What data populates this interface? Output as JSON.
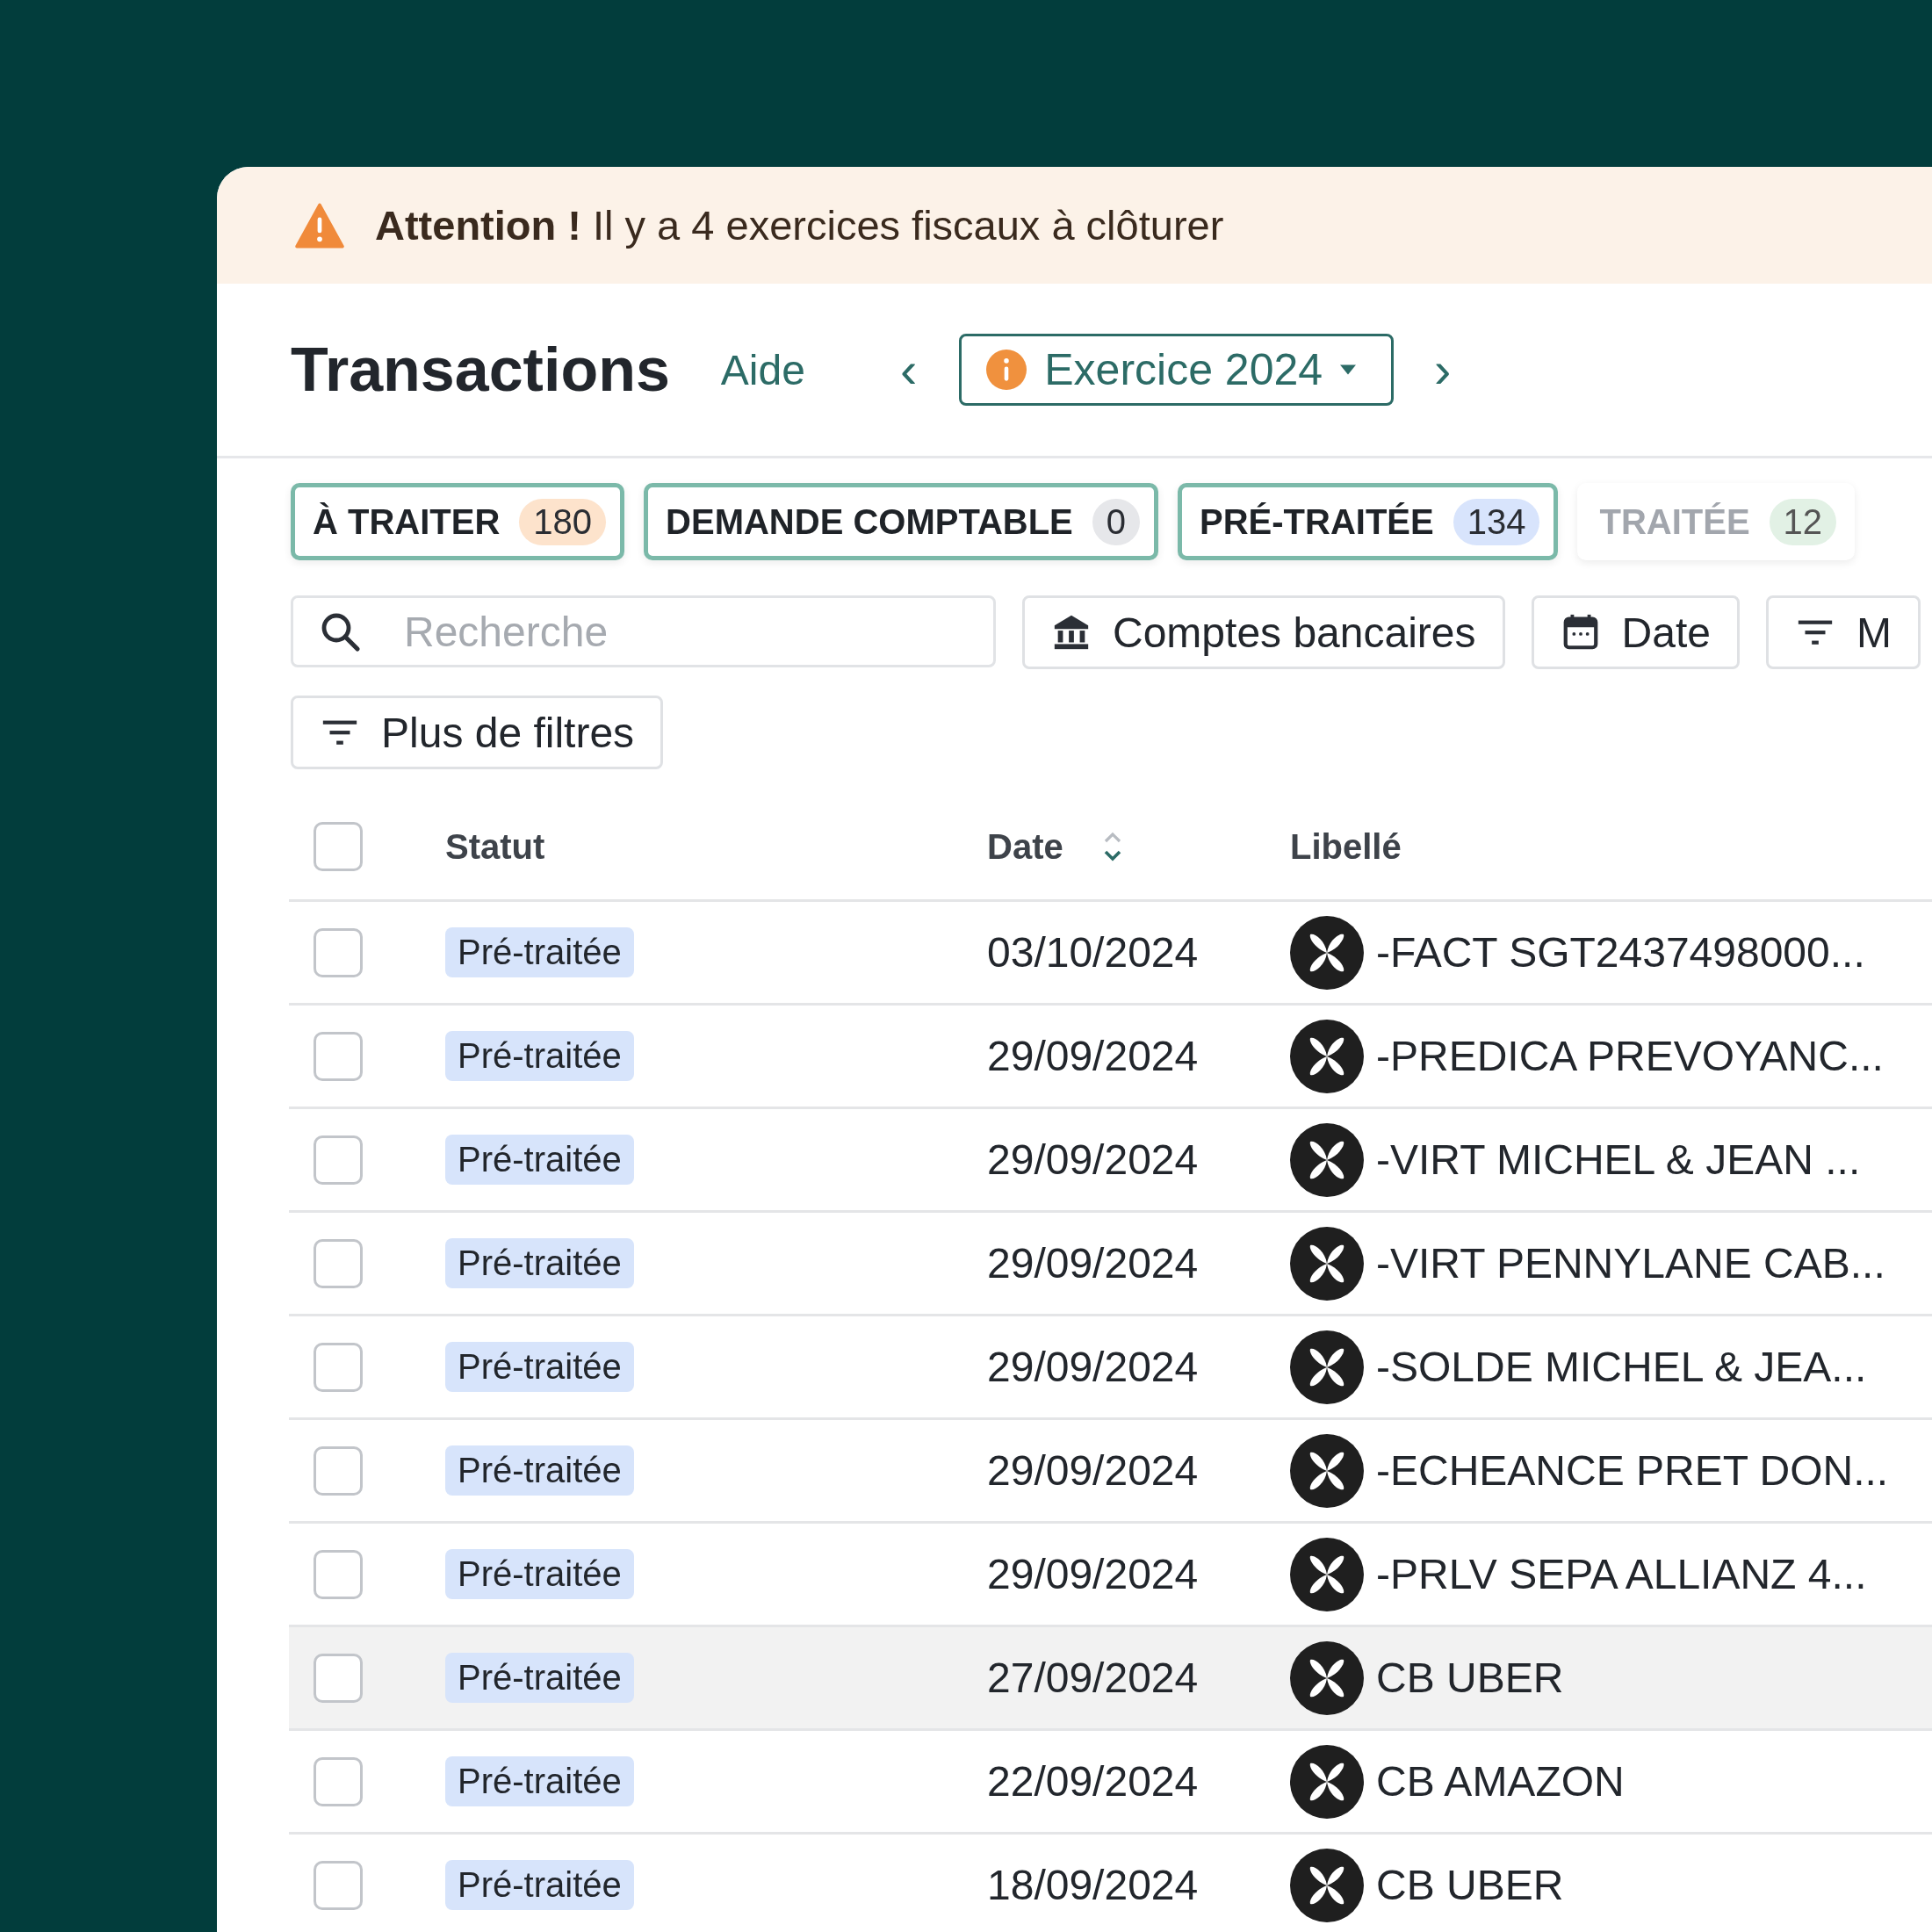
{
  "banner": {
    "kind": "warning",
    "title": "Attention !",
    "message": "Il y a 4 exercices fiscaux à clôturer"
  },
  "header": {
    "title": "Transactions",
    "help_link": "Aide",
    "prev": "‹",
    "next": "›",
    "period": {
      "label": "Exercice 2024",
      "info": true
    }
  },
  "tabs": [
    {
      "label": "À TRAITER",
      "count": "180",
      "color": "#fde3cc",
      "selected": true
    },
    {
      "label": "DEMANDE COMPTABLE",
      "count": "0",
      "color": "#e6e7ea",
      "selected": true
    },
    {
      "label": "PRÉ-TRAITÉE",
      "count": "134",
      "color": "#d8e4fc",
      "selected": true
    },
    {
      "label": "TRAITÉE",
      "count": "12",
      "color": "#e2f1e5",
      "selected": false
    }
  ],
  "search": {
    "placeholder": "Recherche"
  },
  "filters": [
    {
      "kind": "bank",
      "label": "Comptes bancaires"
    },
    {
      "kind": "calendar",
      "label": "Date"
    },
    {
      "kind": "filter",
      "label": "M"
    }
  ],
  "more_filters": {
    "label": "Plus de filtres"
  },
  "table": {
    "select_all": {
      "checked": false
    },
    "columns": [
      {
        "label": "Statut",
        "sortable": false
      },
      {
        "label": "Date",
        "sortable": true
      },
      {
        "label": "Libellé",
        "sortable": false
      }
    ],
    "rows": [
      {
        "checked": false,
        "highlighted": false,
        "status": "Pré-traitée",
        "date": "03/10/2024",
        "label": "-FACT SGT2437498000..."
      },
      {
        "checked": false,
        "highlighted": false,
        "status": "Pré-traitée",
        "date": "29/09/2024",
        "label": "-PREDICA PREVOYANC..."
      },
      {
        "checked": false,
        "highlighted": false,
        "status": "Pré-traitée",
        "date": "29/09/2024",
        "label": "-VIRT MICHEL & JEAN ..."
      },
      {
        "checked": false,
        "highlighted": false,
        "status": "Pré-traitée",
        "date": "29/09/2024",
        "label": "-VIRT PENNYLANE CAB..."
      },
      {
        "checked": false,
        "highlighted": false,
        "status": "Pré-traitée",
        "date": "29/09/2024",
        "label": "-SOLDE MICHEL & JEA..."
      },
      {
        "checked": false,
        "highlighted": false,
        "status": "Pré-traitée",
        "date": "29/09/2024",
        "label": "-ECHEANCE PRET DON..."
      },
      {
        "checked": false,
        "highlighted": false,
        "status": "Pré-traitée",
        "date": "29/09/2024",
        "label": "-PRLV SEPA ALLIANZ 4..."
      },
      {
        "checked": false,
        "highlighted": true,
        "status": "Pré-traitée",
        "date": "27/09/2024",
        "label": "CB UBER"
      },
      {
        "checked": false,
        "highlighted": false,
        "status": "Pré-traitée",
        "date": "22/09/2024",
        "label": "CB AMAZON"
      },
      {
        "checked": false,
        "highlighted": false,
        "status": "Pré-traitée",
        "date": "18/09/2024",
        "label": "CB UBER"
      }
    ]
  }
}
